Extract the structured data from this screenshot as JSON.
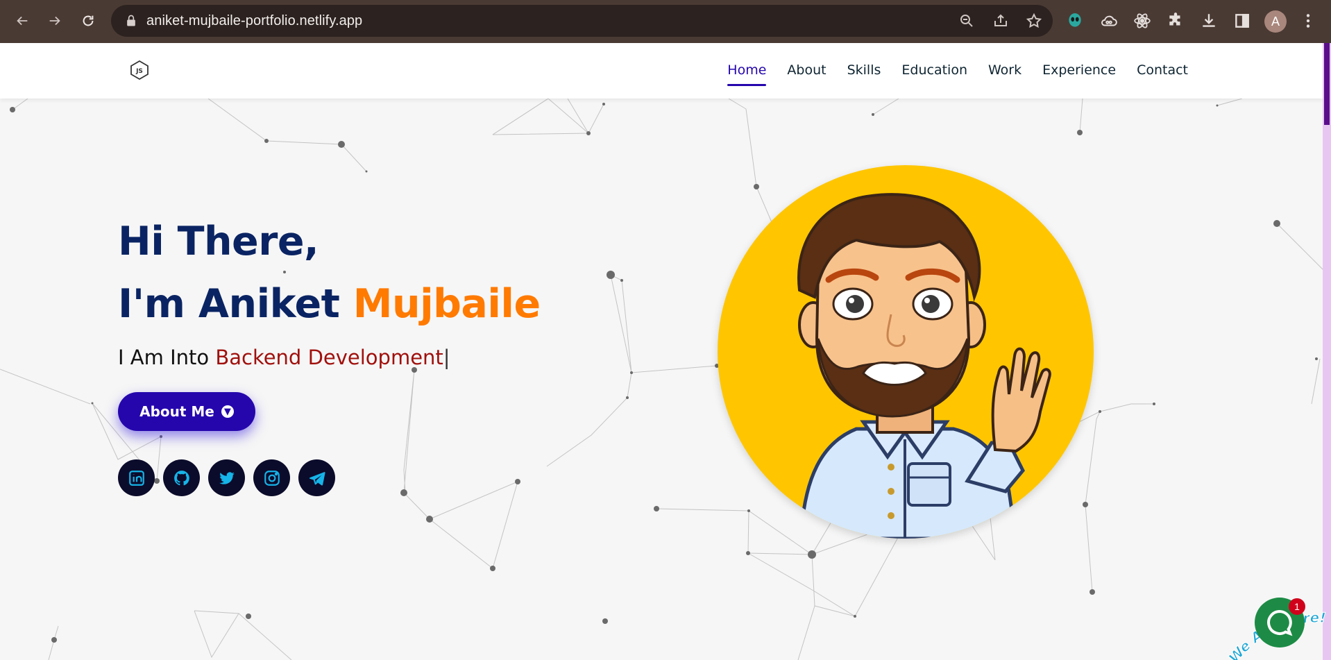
{
  "browser": {
    "url": "aniket-mujbaile-portfolio.netlify.app",
    "profile_initial": "A"
  },
  "nav": {
    "items": [
      {
        "label": "Home",
        "active": true
      },
      {
        "label": "About"
      },
      {
        "label": "Skills"
      },
      {
        "label": "Education"
      },
      {
        "label": "Work"
      },
      {
        "label": "Experience"
      },
      {
        "label": "Contact"
      }
    ]
  },
  "hero": {
    "greeting": "Hi There,",
    "name_prefix": "I'm Aniket ",
    "name_accent": "Mujbaile",
    "typed_prefix": "I Am Into ",
    "typed_role": "Backend Development",
    "caret": "|",
    "button_label": "About Me"
  },
  "socials": [
    "linkedin-icon",
    "github-icon",
    "twitter-icon",
    "instagram-icon",
    "telegram-icon"
  ],
  "chat": {
    "tagline": "We Are Here!",
    "badge_count": "1"
  },
  "colors": {
    "primary": "#2506ad",
    "accent": "#ff7a00",
    "heading": "#0a2463",
    "role": "#a0100c",
    "avatar_bg": "#ffc600"
  }
}
